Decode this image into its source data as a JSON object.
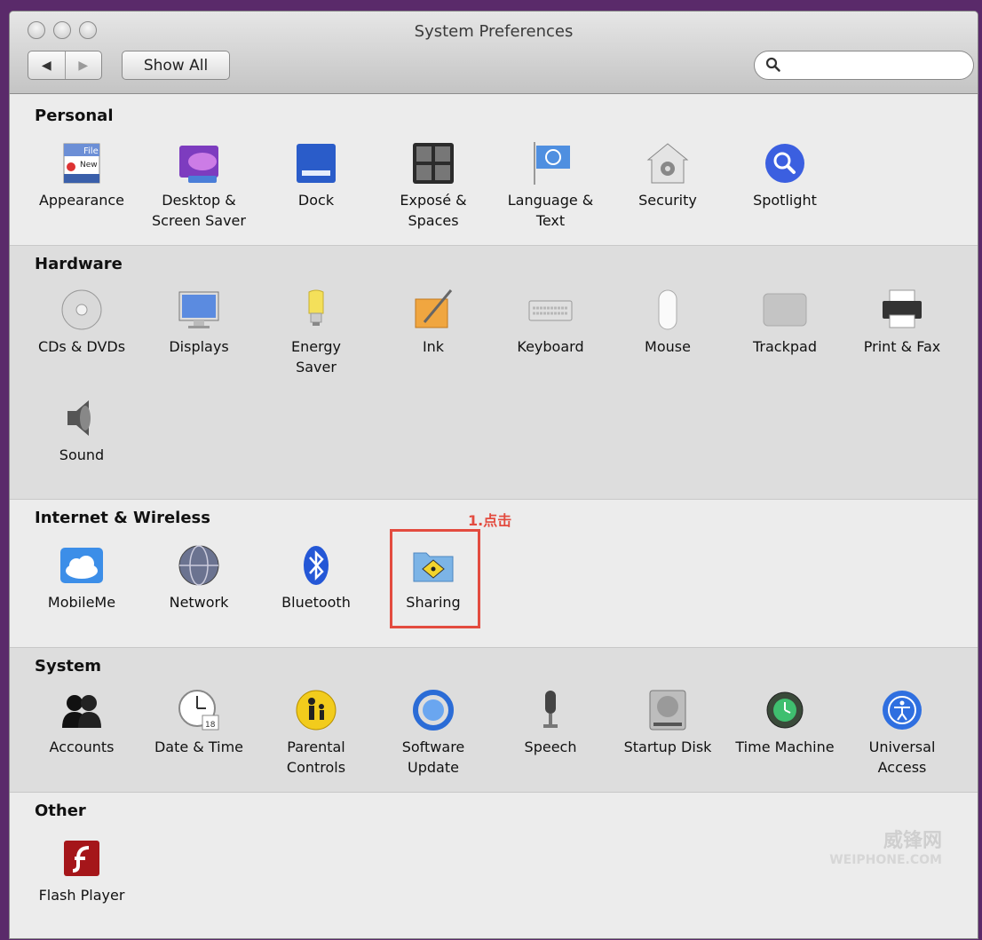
{
  "window": {
    "title": "System Preferences"
  },
  "toolbar": {
    "back": "◀",
    "forward": "▶",
    "show_all": "Show All",
    "search_placeholder": ""
  },
  "sections": {
    "personal": {
      "title": "Personal",
      "items": [
        "Appearance",
        "Desktop &\nScreen Saver",
        "Dock",
        "Exposé &\nSpaces",
        "Language &\nText",
        "Security",
        "Spotlight"
      ]
    },
    "hardware": {
      "title": "Hardware",
      "items": [
        "CDs & DVDs",
        "Displays",
        "Energy\nSaver",
        "Ink",
        "Keyboard",
        "Mouse",
        "Trackpad",
        "Print & Fax",
        "Sound"
      ]
    },
    "internet": {
      "title": "Internet & Wireless",
      "items": [
        "MobileMe",
        "Network",
        "Bluetooth",
        "Sharing"
      ]
    },
    "system": {
      "title": "System",
      "items": [
        "Accounts",
        "Date & Time",
        "Parental\nControls",
        "Software\nUpdate",
        "Speech",
        "Startup Disk",
        "Time Machine",
        "Universal\nAccess"
      ]
    },
    "other": {
      "title": "Other",
      "items": [
        "Flash Player"
      ]
    }
  },
  "annotation": {
    "label": "1.点击"
  },
  "icon_labels": {
    "appearance_file": "File",
    "appearance_new": "New",
    "date_day": "18"
  },
  "watermark": {
    "line1": "威锋网",
    "line2": "WEIPHONE.COM"
  }
}
